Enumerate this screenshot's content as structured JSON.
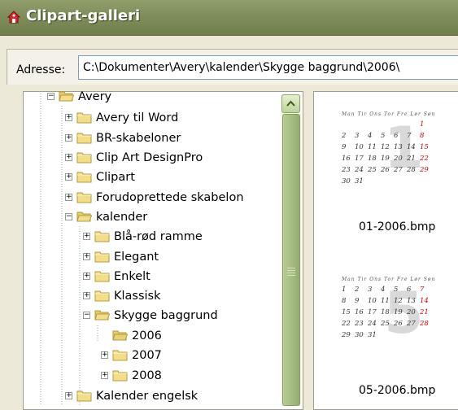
{
  "window": {
    "title": "Clipart-galleri"
  },
  "address": {
    "label": "Adresse:",
    "value": "C:\\Dokumenter\\Avery\\kalender\\Skygge baggrund\\2006\\"
  },
  "tree": [
    {
      "label": "Avery",
      "expander": "minus",
      "open": true
    },
    {
      "label": "Avery til Word",
      "expander": "plus"
    },
    {
      "label": "BR-skabeloner",
      "expander": "plus"
    },
    {
      "label": "Clip Art DesignPro",
      "expander": "plus"
    },
    {
      "label": "Clipart",
      "expander": "plus"
    },
    {
      "label": "Forudoprettede skabelon",
      "expander": "plus"
    },
    {
      "label": "kalender",
      "expander": "minus",
      "open": true
    },
    {
      "label": "Blå-rød ramme",
      "expander": "plus"
    },
    {
      "label": "Elegant",
      "expander": "plus"
    },
    {
      "label": "Enkelt",
      "expander": "plus"
    },
    {
      "label": "Klassisk",
      "expander": "plus"
    },
    {
      "label": "Skygge baggrund",
      "expander": "minus",
      "open": true
    },
    {
      "label": "2006",
      "expander": "none",
      "open": true,
      "selected": true
    },
    {
      "label": "2007",
      "expander": "plus"
    },
    {
      "label": "2008",
      "expander": "plus"
    },
    {
      "label": "Kalender engelsk",
      "expander": "plus"
    }
  ],
  "previews": [
    {
      "filename": "01-2006.bmp",
      "weekdays": "Man Tir Ons Tor Fre Lør Søn",
      "month_numeral": "1",
      "rows": [
        [
          "",
          "",
          "",
          "",
          "",
          "",
          "1"
        ],
        [
          "2",
          "3",
          "4",
          "5",
          "6",
          "7",
          "8"
        ],
        [
          "9",
          "10",
          "11",
          "12",
          "13",
          "14",
          "15"
        ],
        [
          "16",
          "17",
          "18",
          "19",
          "20",
          "21",
          "22"
        ],
        [
          "23",
          "24",
          "25",
          "26",
          "27",
          "28",
          "29"
        ],
        [
          "30",
          "31",
          "",
          "",
          "",
          "",
          ""
        ]
      ]
    },
    {
      "filename": "05-2006.bmp",
      "weekdays": "Man Tir Ons Tor Fre Lør Søn",
      "month_numeral": "5",
      "rows": [
        [
          "1",
          "2",
          "3",
          "4",
          "5",
          "6",
          "7"
        ],
        [
          "8",
          "9",
          "10",
          "11",
          "12",
          "13",
          "14"
        ],
        [
          "15",
          "16",
          "17",
          "18",
          "19",
          "20",
          "21"
        ],
        [
          "22",
          "23",
          "24",
          "25",
          "26",
          "27",
          "28"
        ],
        [
          "29",
          "30",
          "31",
          "",
          "",
          "",
          ""
        ]
      ]
    }
  ],
  "colors": {
    "accent": "#7d8c58",
    "weekend": "#cc0000"
  }
}
